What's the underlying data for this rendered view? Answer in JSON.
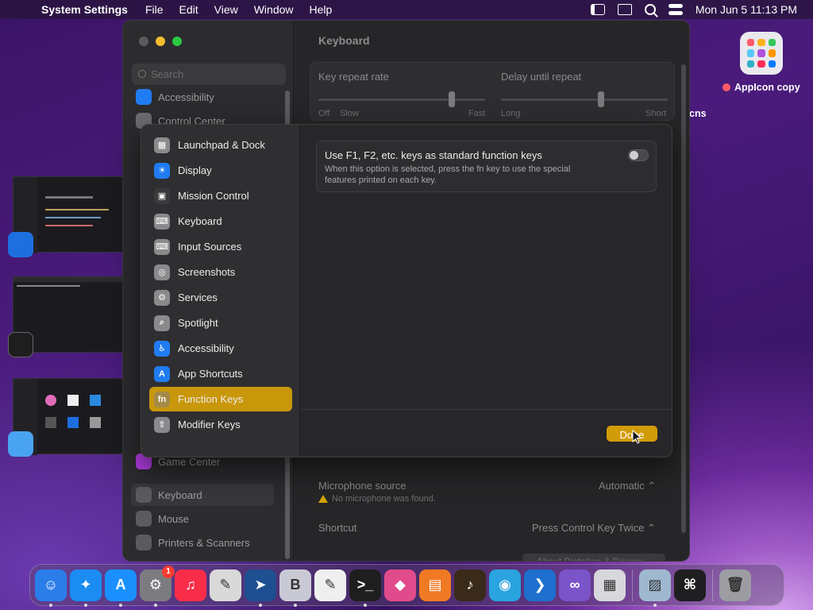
{
  "menubar": {
    "app_name": "System Settings",
    "menus": [
      "File",
      "Edit",
      "View",
      "Window",
      "Help"
    ],
    "clock": "Mon Jun 5  11:13 PM"
  },
  "desktop": {
    "file_label": "AppIcon copy",
    "file_suffix": "cns"
  },
  "settings_window": {
    "search_placeholder": "Search",
    "title": "Keyboard",
    "sidebar_items": [
      {
        "label": "Accessibility",
        "icon": "accessibility-icon",
        "color": "#1f7cf2"
      },
      {
        "label": "Control Center",
        "icon": "control-center-icon",
        "color": "#6d6d70"
      },
      {
        "label": "Game Center",
        "icon": "game-center-icon",
        "color": "#b03de0"
      },
      {
        "label": "Keyboard",
        "icon": "keyboard-icon",
        "color": "#8e8e91"
      },
      {
        "label": "Mouse",
        "icon": "mouse-icon",
        "color": "#8e8e91"
      },
      {
        "label": "Printers & Scanners",
        "icon": "printer-icon",
        "color": "#8e8e91"
      }
    ],
    "key_repeat": {
      "label": "Key repeat rate",
      "off": "Off",
      "slow": "Slow",
      "fast": "Fast",
      "value": 0.8
    },
    "delay_repeat": {
      "label": "Delay until repeat",
      "long": "Long",
      "short": "Short",
      "value": 0.6
    },
    "microphone": {
      "label": "Microphone source",
      "value": "Automatic",
      "warning": "No microphone was found."
    },
    "shortcut": {
      "label": "Shortcut",
      "value": "Press Control Key Twice"
    },
    "about_button": "About Dictation & Privacy..."
  },
  "sheet": {
    "items": [
      {
        "label": "Launchpad & Dock",
        "icon": "launchpad-icon",
        "color": "#8a8a8d",
        "glyph": "▦"
      },
      {
        "label": "Display",
        "icon": "display-icon",
        "color": "#1f7cf2",
        "glyph": "☀"
      },
      {
        "label": "Mission Control",
        "icon": "mission-control-icon",
        "color": "#3a3a3c",
        "glyph": "▣"
      },
      {
        "label": "Keyboard",
        "icon": "keyboard-icon",
        "color": "#8a8a8d",
        "glyph": "⌨"
      },
      {
        "label": "Input Sources",
        "icon": "input-sources-icon",
        "color": "#8a8a8d",
        "glyph": "⌨"
      },
      {
        "label": "Screenshots",
        "icon": "screenshot-icon",
        "color": "#8a8a8d",
        "glyph": "◎"
      },
      {
        "label": "Services",
        "icon": "services-icon",
        "color": "#8a8a8d",
        "glyph": "⚙"
      },
      {
        "label": "Spotlight",
        "icon": "spotlight-icon",
        "color": "#8a8a8d",
        "glyph": "⌕"
      },
      {
        "label": "Accessibility",
        "icon": "accessibility-icon",
        "color": "#1f7cf2",
        "glyph": "♿"
      },
      {
        "label": "App Shortcuts",
        "icon": "app-shortcuts-icon",
        "color": "#1f7cf2",
        "glyph": "A"
      },
      {
        "label": "Function Keys",
        "icon": "fn-icon",
        "color": "#a58a46",
        "glyph": "fn"
      },
      {
        "label": "Modifier Keys",
        "icon": "modifier-keys-icon",
        "color": "#8a8a8d",
        "glyph": "⇧"
      }
    ],
    "selected_index": 10,
    "fn_option": {
      "title": "Use F1, F2, etc. keys as standard function keys",
      "description": "When this option is selected, press the fn key to use the special features printed on each key.",
      "enabled": false
    },
    "done_label": "Done"
  },
  "dock": {
    "apps": [
      {
        "name": "finder-icon",
        "color": "#2b7de9",
        "running": true,
        "glyph": "☺"
      },
      {
        "name": "safari-icon",
        "color": "#1b8cf2",
        "running": true,
        "glyph": "✦"
      },
      {
        "name": "app-store-icon",
        "color": "#1a90ff",
        "running": true,
        "glyph": "A"
      },
      {
        "name": "system-settings-icon",
        "color": "#7c7c80",
        "running": true,
        "glyph": "⚙",
        "badge": "1"
      },
      {
        "name": "music-icon",
        "color": "#fa2d48",
        "running": false,
        "glyph": "♫"
      },
      {
        "name": "script-editor-icon",
        "color": "#d9d9d9",
        "running": false,
        "glyph": "✎"
      },
      {
        "name": "swift-playgrounds-icon",
        "color": "#1d4f91",
        "running": true,
        "glyph": "➤"
      },
      {
        "name": "bbedit-icon",
        "color": "#c9c9d6",
        "running": true,
        "glyph": "B"
      },
      {
        "name": "textedit-icon",
        "color": "#efefef",
        "running": false,
        "glyph": "✎"
      },
      {
        "name": "terminal-icon",
        "color": "#1e1e1e",
        "running": true,
        "glyph": ">_"
      },
      {
        "name": "shortcuts-icon",
        "color": "#e14b8c",
        "running": false,
        "glyph": "◆"
      },
      {
        "name": "pages-keynote-icon",
        "color": "#f07a24",
        "running": false,
        "glyph": "▤"
      },
      {
        "name": "instruments-icon",
        "color": "#3a2a1a",
        "running": false,
        "glyph": "♪"
      },
      {
        "name": "quicktime-icon",
        "color": "#2aa4e0",
        "running": false,
        "glyph": "◉"
      },
      {
        "name": "vscode-icon",
        "color": "#1e6fce",
        "running": false,
        "glyph": "❯"
      },
      {
        "name": "visual-studio-icon",
        "color": "#7a54c8",
        "running": false,
        "glyph": "∞"
      },
      {
        "name": "launchpad-icon",
        "color": "#d7d7dc",
        "running": false,
        "glyph": "▦"
      },
      {
        "name": "preview-icon",
        "color": "#9fb8cf",
        "running": true,
        "glyph": "▨"
      },
      {
        "name": "keyboard-shortcut-icon",
        "color": "#1f1f21",
        "running": false,
        "glyph": "⌘"
      },
      {
        "name": "trash-icon",
        "color": "#9c9ca2",
        "running": false,
        "glyph": "🗑"
      }
    ]
  }
}
